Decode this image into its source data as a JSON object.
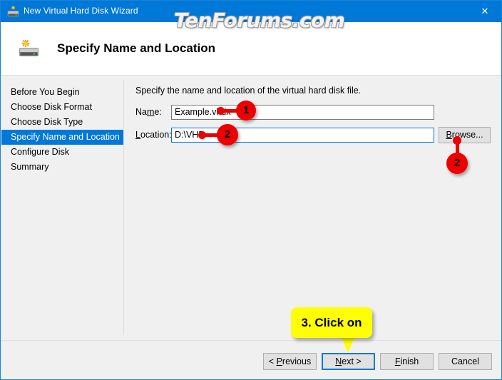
{
  "window": {
    "title": "New Virtual Hard Disk Wizard",
    "title_icon": "virtual-hard-disk-icon",
    "close_label": "✕",
    "border_color": "#1884d8",
    "titlebar_color": "#0078d7"
  },
  "watermark": {
    "text": "TenForums.com"
  },
  "header": {
    "icon": "virtual-hard-disk-icon",
    "title": "Specify Name and Location"
  },
  "sidebar": {
    "items": [
      {
        "label": "Before You Begin",
        "selected": false
      },
      {
        "label": "Choose Disk Format",
        "selected": false
      },
      {
        "label": "Choose Disk Type",
        "selected": false
      },
      {
        "label": "Specify Name and Location",
        "selected": true
      },
      {
        "label": "Configure Disk",
        "selected": false
      },
      {
        "label": "Summary",
        "selected": false
      }
    ],
    "selected_color": "#0078d7"
  },
  "main": {
    "intro": "Specify the name and location of the virtual hard disk file.",
    "name_label_pre": "Na",
    "name_label_mnemonic": "m",
    "name_label_post": "e:",
    "name_value": "Example.vhdx",
    "location_label_mnemonic": "L",
    "location_label_post": "ocation:",
    "location_value": "D:\\VHD",
    "browse_pre": "",
    "browse_mnemonic": "B",
    "browse_post": "rowse...",
    "focused_field": "location"
  },
  "footer": {
    "previous_pre": "< ",
    "previous_mnemonic": "P",
    "previous_post": "revious",
    "next_pre": "",
    "next_mnemonic": "N",
    "next_post": "ext >",
    "finish_pre": "",
    "finish_mnemonic": "F",
    "finish_post": "inish",
    "cancel_label": "Cancel",
    "default_button": "Next >"
  },
  "annotations": {
    "badge_color": "#ee0000",
    "badge_1": "1",
    "badge_2": "2",
    "badge_3": "2",
    "callout_text": "3. Click on",
    "callout_color": "#ffff00"
  }
}
